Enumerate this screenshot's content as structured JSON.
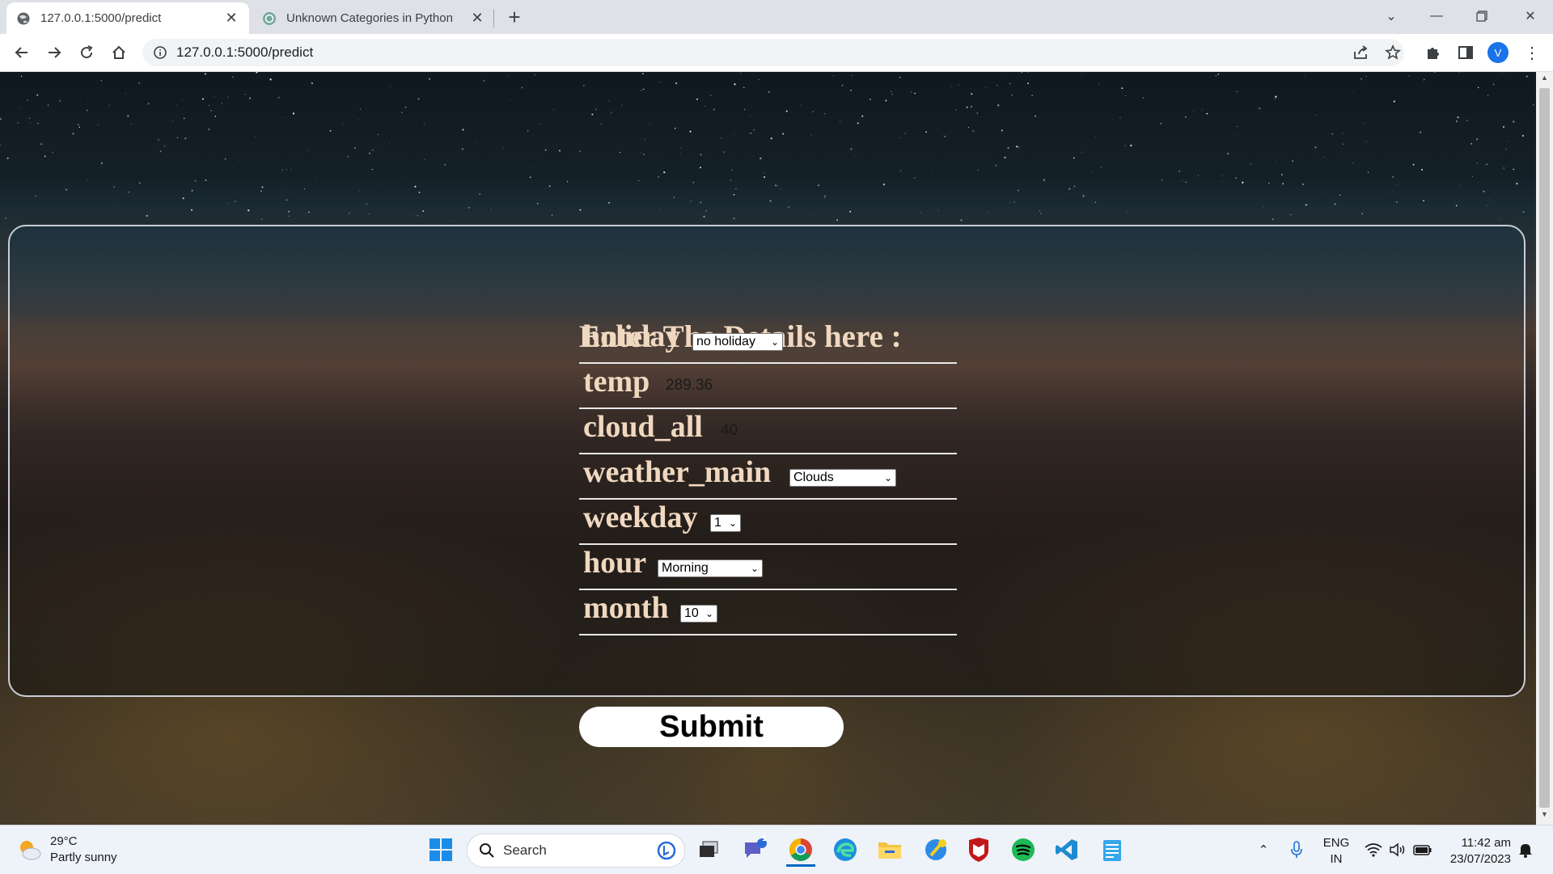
{
  "browser": {
    "tabs": [
      {
        "title": "127.0.0.1:5000/predict",
        "active": true
      },
      {
        "title": "Unknown Categories in Python",
        "active": false
      }
    ],
    "url": "127.0.0.1:5000/predict",
    "profile_initial": "V"
  },
  "form": {
    "title": "Enter The Details here :",
    "fields": [
      {
        "label": "holiday",
        "type": "select",
        "value": "no holiday"
      },
      {
        "label": "temp",
        "type": "text",
        "value": "289.36"
      },
      {
        "label": "cloud_all",
        "type": "text",
        "value": "40"
      },
      {
        "label": "weather_main",
        "type": "select",
        "value": "Clouds"
      },
      {
        "label": "weekday",
        "type": "select",
        "value": "1"
      },
      {
        "label": "hour",
        "type": "select",
        "value": "Morning"
      },
      {
        "label": "month",
        "type": "select",
        "value": "10"
      }
    ],
    "submit_label": "Submit"
  },
  "taskbar": {
    "weather_temp": "29°C",
    "weather_desc": "Partly sunny",
    "search_placeholder": "Search",
    "teams_badge": "1",
    "lang_line1": "ENG",
    "lang_line2": "IN",
    "time": "11:42 am",
    "date": "23/07/2023"
  }
}
